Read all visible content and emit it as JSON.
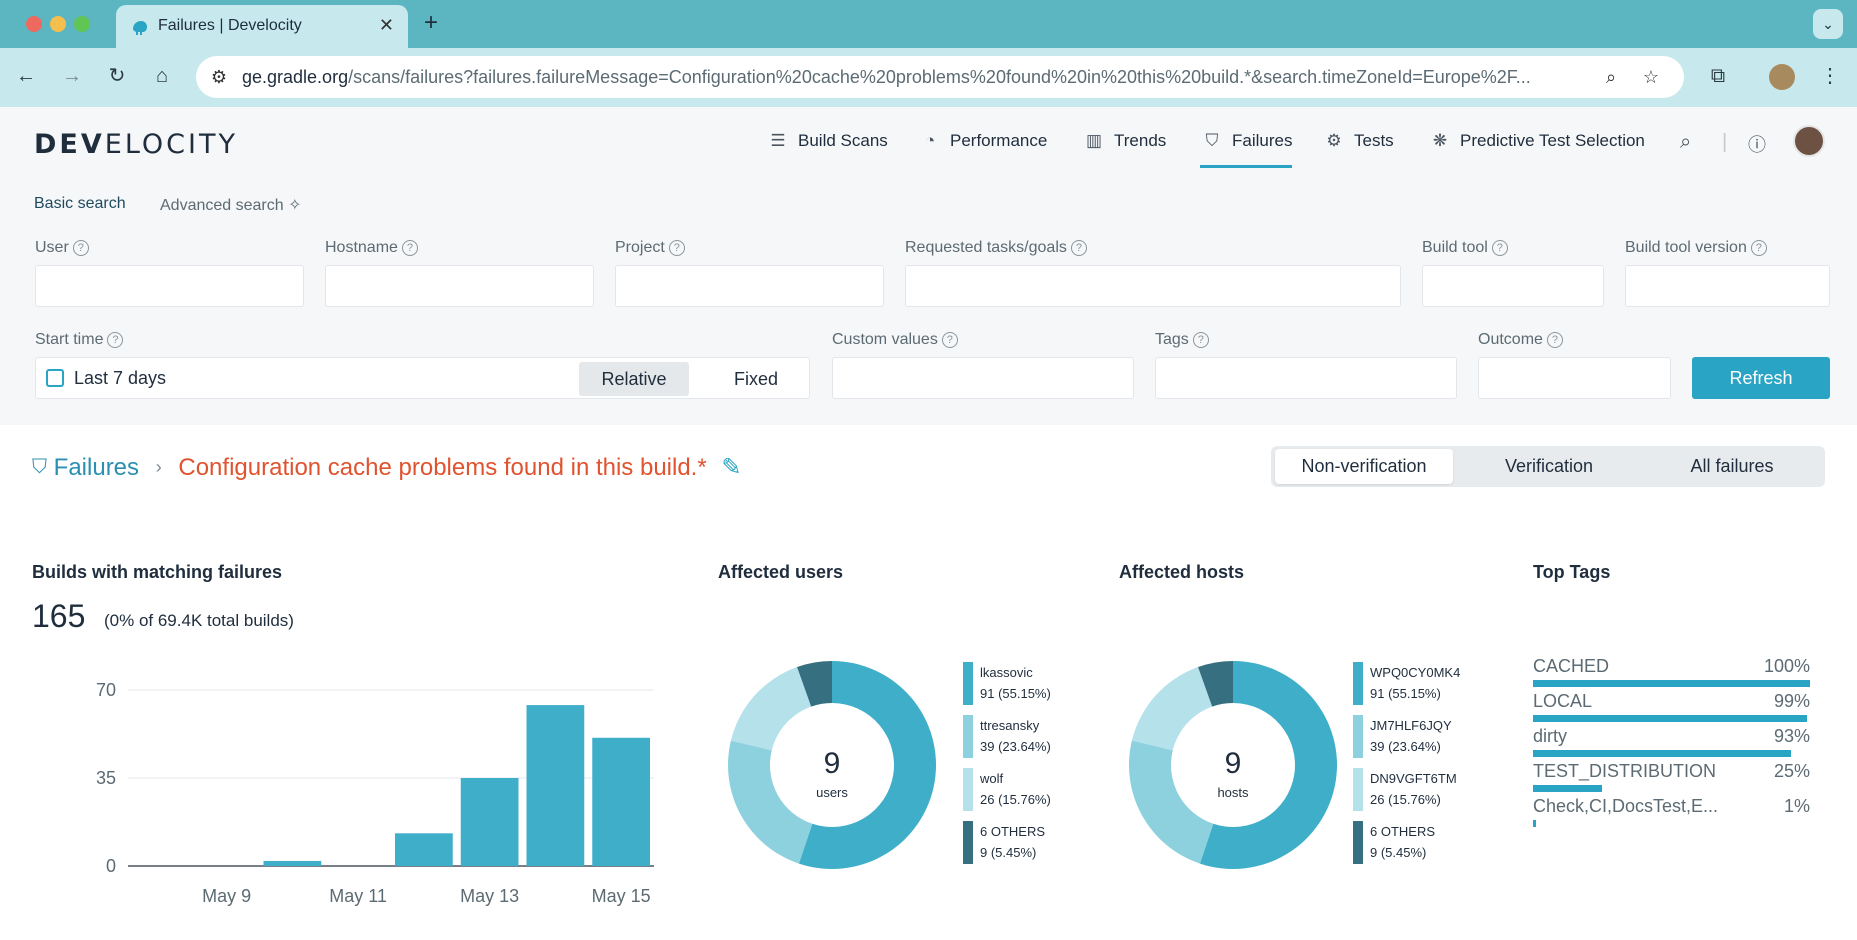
{
  "browser": {
    "tab_title": "Failures | Develocity",
    "url_domain": "ge.gradle.org",
    "url_path": "/scans/failures?failures.failureMessage=Configuration%20cache%20problems%20found%20in%20this%20build.*&search.timeZoneId=Europe%2F..."
  },
  "header": {
    "logo_bold": "DEV",
    "logo_rest": "ELOCITY",
    "nav": [
      {
        "label": "Build Scans",
        "icon": "list-icon"
      },
      {
        "label": "Performance",
        "icon": "gauge-icon"
      },
      {
        "label": "Trends",
        "icon": "bar-chart-icon"
      },
      {
        "label": "Failures",
        "icon": "shield-icon",
        "active": true
      },
      {
        "label": "Tests",
        "icon": "tests-icon"
      },
      {
        "label": "Predictive Test Selection",
        "icon": "brain-icon"
      }
    ]
  },
  "search": {
    "basic_label": "Basic search",
    "advanced_label": "Advanced search",
    "fields": {
      "user": "User",
      "hostname": "Hostname",
      "project": "Project",
      "requested_tasks": "Requested tasks/goals",
      "build_tool": "Build tool",
      "build_tool_version": "Build tool version",
      "start_time": "Start time",
      "custom_values": "Custom values",
      "tags": "Tags",
      "outcome": "Outcome"
    },
    "start_time_value": "Last 7 days",
    "relative_label": "Relative",
    "fixed_label": "Fixed",
    "refresh_label": "Refresh"
  },
  "breadcrumb": {
    "root": "Failures",
    "separator": "›",
    "message": "Configuration cache problems found in this build.*"
  },
  "filter_tabs": {
    "non_verification": "Non-verification",
    "verification": "Verification",
    "all_failures": "All failures",
    "selected": "Non-verification"
  },
  "builds_panel": {
    "title": "Builds with matching failures",
    "count": "165",
    "subtitle": "(0% of 69.4K total builds)"
  },
  "users_panel": {
    "title": "Affected users",
    "center_value": "9",
    "center_label": "users",
    "legend": [
      {
        "name": "lkassovic",
        "detail": "91 (55.15%)",
        "color": "#3fafc9"
      },
      {
        "name": "ttresansky",
        "detail": "39 (23.64%)",
        "color": "#8dd0de"
      },
      {
        "name": "wolf",
        "detail": "26 (15.76%)",
        "color": "#b5e1ea"
      },
      {
        "name": "6 OTHERS",
        "detail": "9 (5.45%)",
        "color": "#356f80"
      }
    ]
  },
  "hosts_panel": {
    "title": "Affected hosts",
    "center_value": "9",
    "center_label": "hosts",
    "legend": [
      {
        "name": "WPQ0CY0MK4",
        "detail": "91 (55.15%)",
        "color": "#3fafc9"
      },
      {
        "name": "JM7HLF6JQY",
        "detail": "39 (23.64%)",
        "color": "#8dd0de"
      },
      {
        "name": "DN9VGFT6TM",
        "detail": "26 (15.76%)",
        "color": "#b5e1ea"
      },
      {
        "name": "6 OTHERS",
        "detail": "9 (5.45%)",
        "color": "#356f80"
      }
    ]
  },
  "tags_panel": {
    "title": "Top Tags",
    "tags": [
      {
        "name": "CACHED",
        "pct_label": "100%",
        "fraction": 1.0
      },
      {
        "name": "LOCAL",
        "pct_label": "99%",
        "fraction": 0.99
      },
      {
        "name": "dirty",
        "pct_label": "93%",
        "fraction": 0.93
      },
      {
        "name": "TEST_DISTRIBUTION",
        "pct_label": "25%",
        "fraction": 0.25
      },
      {
        "name": "Check,CI,DocsTest,E...",
        "pct_label": "1%",
        "fraction": 0.01
      }
    ]
  },
  "chart_data": [
    {
      "type": "bar",
      "categories": [
        "May 8",
        "May 9",
        "May 10",
        "May 11",
        "May 12",
        "May 13",
        "May 14",
        "May 15"
      ],
      "values": [
        0,
        0,
        2,
        0,
        13,
        35,
        64,
        51
      ],
      "xticks": [
        "May 9",
        "May 11",
        "May 13",
        "May 15"
      ],
      "yticks": [
        "0",
        "35",
        "70"
      ],
      "ylim": [
        0,
        70
      ],
      "color": "#3fafc9"
    },
    {
      "type": "pie",
      "labels": [
        "lkassovic",
        "ttresansky",
        "wolf",
        "6 OTHERS"
      ],
      "values": [
        91,
        39,
        26,
        9
      ]
    },
    {
      "type": "pie",
      "labels": [
        "WPQ0CY0MK4",
        "JM7HLF6JQY",
        "DN9VGFT6TM",
        "6 OTHERS"
      ],
      "values": [
        91,
        39,
        26,
        9
      ]
    }
  ]
}
